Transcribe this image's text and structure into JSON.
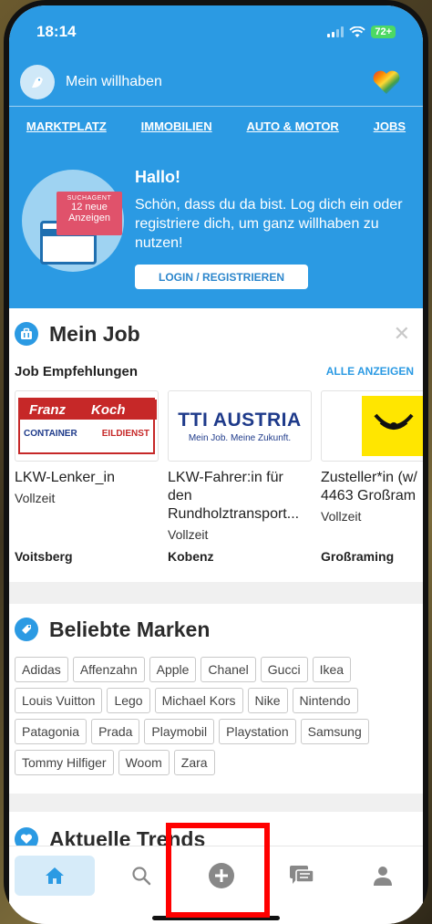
{
  "status": {
    "time": "18:14",
    "battery": "72+"
  },
  "topbar": {
    "title": "Mein willhaben"
  },
  "categories": [
    "MARKTPLATZ",
    "IMMOBILIEN",
    "AUTO & MOTOR",
    "JOBS"
  ],
  "hero": {
    "tag_small": "SUCHAGENT",
    "tag_big": "12 neue Anzeigen",
    "title": "Hallo!",
    "text": "Schön, dass du da bist. Log dich ein oder registriere dich, um ganz willhaben zu nutzen!",
    "button": "LOGIN / REGISTRIEREN"
  },
  "job_section": {
    "title": "Mein Job",
    "subtitle": "Job Empfehlungen",
    "show_all": "ALLE ANZEIGEN",
    "jobs": [
      {
        "logo_line1": "Franz",
        "logo_line2": "Koch",
        "logo_line3": "CONTAINER",
        "logo_line4": "EILDIENST",
        "name": "LKW-Lenker_in",
        "type": "Vollzeit",
        "location": "Voitsberg"
      },
      {
        "logo_line1": "TTI AUSTRIA",
        "logo_line2": "Mein Job. Meine Zukunft.",
        "name": "LKW-Fahrer:in für\nden\nRundholztransport...",
        "type": "Vollzeit",
        "location": "Kobenz"
      },
      {
        "name": "Zusteller*in (w/\n4463 Großram",
        "type": "Vollzeit",
        "location": "Großraming"
      }
    ]
  },
  "brands_section": {
    "title": "Beliebte Marken",
    "brands": [
      "Adidas",
      "Affenzahn",
      "Apple",
      "Chanel",
      "Gucci",
      "Ikea",
      "Louis Vuitton",
      "Lego",
      "Michael Kors",
      "Nike",
      "Nintendo",
      "Patagonia",
      "Prada",
      "Playmobil",
      "Playstation",
      "Samsung",
      "Tommy Hilfiger",
      "Woom",
      "Zara"
    ]
  },
  "trends_section": {
    "title": "Aktuelle Trends"
  },
  "colors": {
    "accent": "#2b9ae3",
    "highlight": "#ff0000"
  }
}
